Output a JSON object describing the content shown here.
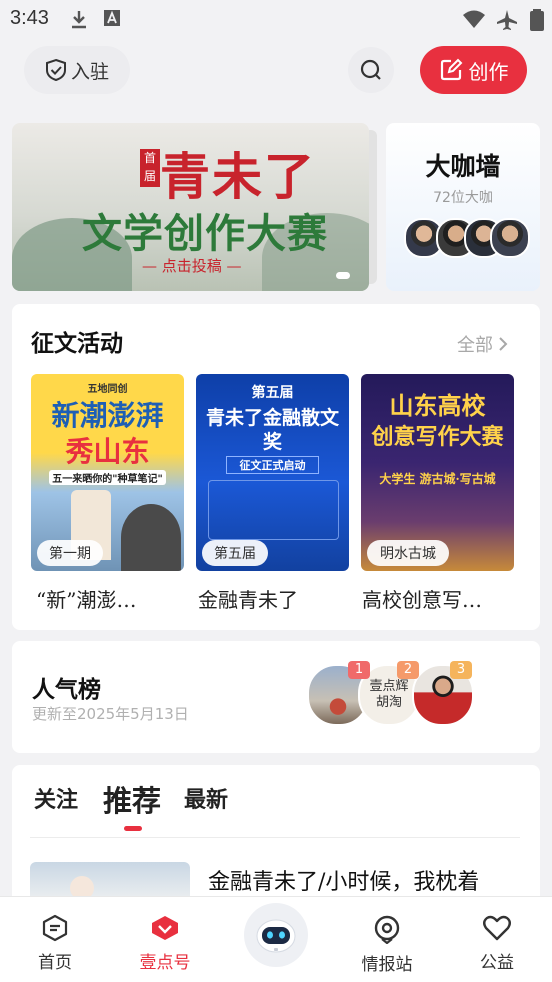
{
  "status_bar": {
    "time": "3:43"
  },
  "header": {
    "join_label": "入驻",
    "create_label": "创作"
  },
  "banner": {
    "tag": "首届",
    "title_line1": "青未了",
    "title_line2": "文学创作大赛",
    "cta": "— 点击投稿 —"
  },
  "wall": {
    "title": "大咖墙",
    "subtitle": "72位大咖"
  },
  "essay_section": {
    "title": "征文活动",
    "all_label": "全部",
    "items": [
      {
        "poster_top": "五地同创",
        "poster_line1": "新潮澎湃",
        "poster_line2": "秀山东",
        "poster_sub": "五一来晒你的\"种草笔记\"",
        "badge": "第一期",
        "caption": "“新”潮澎…"
      },
      {
        "poster_top": "第五届",
        "poster_line1": "青未了金融散文奖",
        "poster_sub": "征文正式启动",
        "badge": "第五届",
        "caption": "金融青未了"
      },
      {
        "poster_line1": "山东高校",
        "poster_line2": "创意写作大赛",
        "poster_sub": "大学生 游古城·写古城",
        "badge": "明水古城",
        "caption": "高校创意写…"
      }
    ]
  },
  "popularity": {
    "title": "人气榜",
    "updated": "更新至2025年5月13日",
    "ranks": [
      "1",
      "2",
      "3"
    ],
    "calligraphy": "壹点辉 胡淘"
  },
  "feed": {
    "tabs": [
      "关注",
      "推荐",
      "最新"
    ],
    "active_tab": "推荐",
    "article_title": "金融青未了/小时候，我枕着"
  },
  "bottom_nav": {
    "items": [
      {
        "label": "首页"
      },
      {
        "label": "壹点号"
      },
      {
        "label": "情报站"
      },
      {
        "label": "公益"
      }
    ],
    "active": "壹点号"
  },
  "colors": {
    "accent": "#e8303f",
    "badge_orange": "#f5a25c"
  }
}
